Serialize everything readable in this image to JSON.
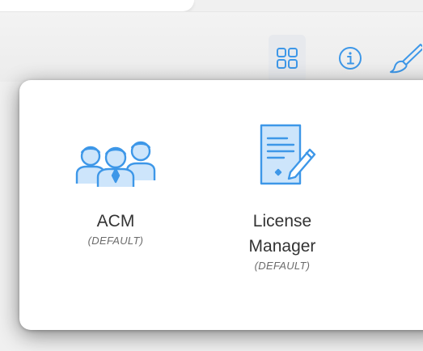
{
  "toolbar": {
    "buttons": [
      {
        "icon": "app-grid-icon",
        "active": true
      },
      {
        "icon": "info-icon",
        "active": false
      },
      {
        "icon": "paintbrush-icon",
        "active": false
      }
    ]
  },
  "app_switcher": {
    "apps": [
      {
        "name_line1": "ACM",
        "name_line2": "",
        "badge": "(DEFAULT)",
        "icon": "users-group-icon"
      },
      {
        "name_line1": "License",
        "name_line2": "Manager",
        "badge": "(DEFAULT)",
        "icon": "document-sign-icon"
      }
    ]
  },
  "colors": {
    "accent": "#3d97e8",
    "text": "#333333",
    "badge_text": "#6b6b6b"
  }
}
